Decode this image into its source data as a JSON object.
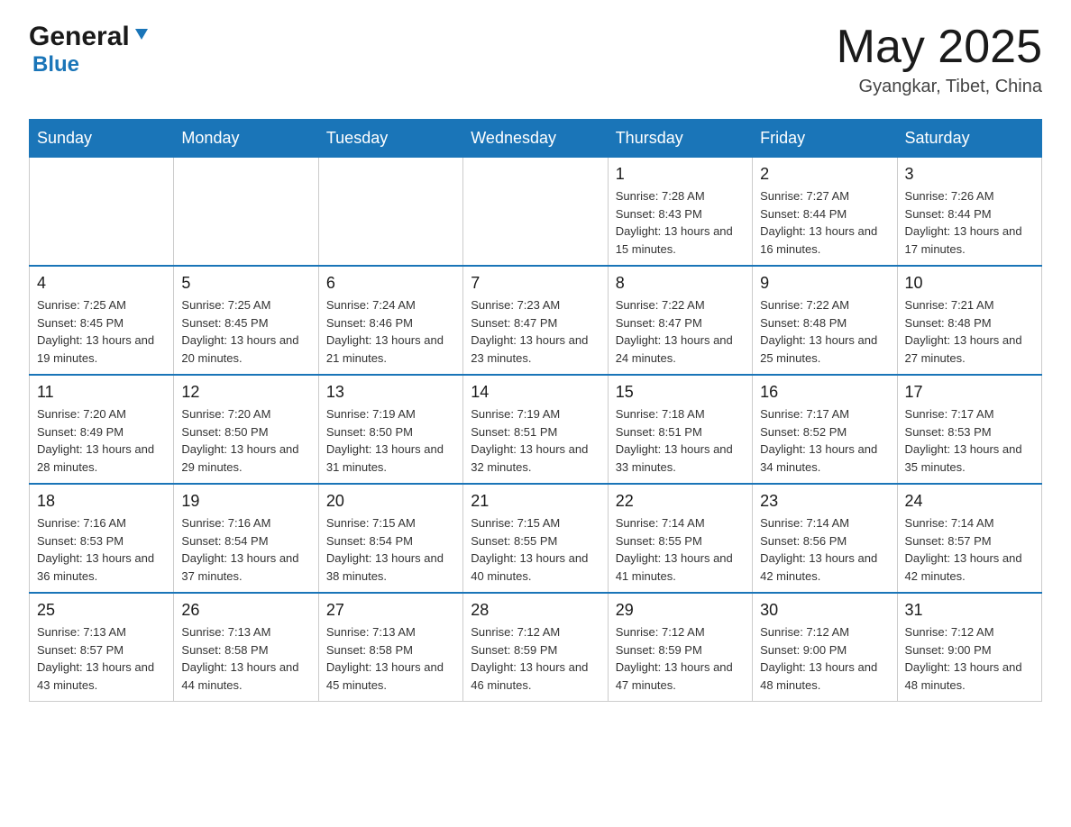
{
  "header": {
    "logo_general": "General",
    "logo_blue": "Blue",
    "month_year": "May 2025",
    "location": "Gyangkar, Tibet, China"
  },
  "days_of_week": [
    "Sunday",
    "Monday",
    "Tuesday",
    "Wednesday",
    "Thursday",
    "Friday",
    "Saturday"
  ],
  "weeks": [
    [
      {
        "day": "",
        "info": ""
      },
      {
        "day": "",
        "info": ""
      },
      {
        "day": "",
        "info": ""
      },
      {
        "day": "",
        "info": ""
      },
      {
        "day": "1",
        "info": "Sunrise: 7:28 AM\nSunset: 8:43 PM\nDaylight: 13 hours and 15 minutes."
      },
      {
        "day": "2",
        "info": "Sunrise: 7:27 AM\nSunset: 8:44 PM\nDaylight: 13 hours and 16 minutes."
      },
      {
        "day": "3",
        "info": "Sunrise: 7:26 AM\nSunset: 8:44 PM\nDaylight: 13 hours and 17 minutes."
      }
    ],
    [
      {
        "day": "4",
        "info": "Sunrise: 7:25 AM\nSunset: 8:45 PM\nDaylight: 13 hours and 19 minutes."
      },
      {
        "day": "5",
        "info": "Sunrise: 7:25 AM\nSunset: 8:45 PM\nDaylight: 13 hours and 20 minutes."
      },
      {
        "day": "6",
        "info": "Sunrise: 7:24 AM\nSunset: 8:46 PM\nDaylight: 13 hours and 21 minutes."
      },
      {
        "day": "7",
        "info": "Sunrise: 7:23 AM\nSunset: 8:47 PM\nDaylight: 13 hours and 23 minutes."
      },
      {
        "day": "8",
        "info": "Sunrise: 7:22 AM\nSunset: 8:47 PM\nDaylight: 13 hours and 24 minutes."
      },
      {
        "day": "9",
        "info": "Sunrise: 7:22 AM\nSunset: 8:48 PM\nDaylight: 13 hours and 25 minutes."
      },
      {
        "day": "10",
        "info": "Sunrise: 7:21 AM\nSunset: 8:48 PM\nDaylight: 13 hours and 27 minutes."
      }
    ],
    [
      {
        "day": "11",
        "info": "Sunrise: 7:20 AM\nSunset: 8:49 PM\nDaylight: 13 hours and 28 minutes."
      },
      {
        "day": "12",
        "info": "Sunrise: 7:20 AM\nSunset: 8:50 PM\nDaylight: 13 hours and 29 minutes."
      },
      {
        "day": "13",
        "info": "Sunrise: 7:19 AM\nSunset: 8:50 PM\nDaylight: 13 hours and 31 minutes."
      },
      {
        "day": "14",
        "info": "Sunrise: 7:19 AM\nSunset: 8:51 PM\nDaylight: 13 hours and 32 minutes."
      },
      {
        "day": "15",
        "info": "Sunrise: 7:18 AM\nSunset: 8:51 PM\nDaylight: 13 hours and 33 minutes."
      },
      {
        "day": "16",
        "info": "Sunrise: 7:17 AM\nSunset: 8:52 PM\nDaylight: 13 hours and 34 minutes."
      },
      {
        "day": "17",
        "info": "Sunrise: 7:17 AM\nSunset: 8:53 PM\nDaylight: 13 hours and 35 minutes."
      }
    ],
    [
      {
        "day": "18",
        "info": "Sunrise: 7:16 AM\nSunset: 8:53 PM\nDaylight: 13 hours and 36 minutes."
      },
      {
        "day": "19",
        "info": "Sunrise: 7:16 AM\nSunset: 8:54 PM\nDaylight: 13 hours and 37 minutes."
      },
      {
        "day": "20",
        "info": "Sunrise: 7:15 AM\nSunset: 8:54 PM\nDaylight: 13 hours and 38 minutes."
      },
      {
        "day": "21",
        "info": "Sunrise: 7:15 AM\nSunset: 8:55 PM\nDaylight: 13 hours and 40 minutes."
      },
      {
        "day": "22",
        "info": "Sunrise: 7:14 AM\nSunset: 8:55 PM\nDaylight: 13 hours and 41 minutes."
      },
      {
        "day": "23",
        "info": "Sunrise: 7:14 AM\nSunset: 8:56 PM\nDaylight: 13 hours and 42 minutes."
      },
      {
        "day": "24",
        "info": "Sunrise: 7:14 AM\nSunset: 8:57 PM\nDaylight: 13 hours and 42 minutes."
      }
    ],
    [
      {
        "day": "25",
        "info": "Sunrise: 7:13 AM\nSunset: 8:57 PM\nDaylight: 13 hours and 43 minutes."
      },
      {
        "day": "26",
        "info": "Sunrise: 7:13 AM\nSunset: 8:58 PM\nDaylight: 13 hours and 44 minutes."
      },
      {
        "day": "27",
        "info": "Sunrise: 7:13 AM\nSunset: 8:58 PM\nDaylight: 13 hours and 45 minutes."
      },
      {
        "day": "28",
        "info": "Sunrise: 7:12 AM\nSunset: 8:59 PM\nDaylight: 13 hours and 46 minutes."
      },
      {
        "day": "29",
        "info": "Sunrise: 7:12 AM\nSunset: 8:59 PM\nDaylight: 13 hours and 47 minutes."
      },
      {
        "day": "30",
        "info": "Sunrise: 7:12 AM\nSunset: 9:00 PM\nDaylight: 13 hours and 48 minutes."
      },
      {
        "day": "31",
        "info": "Sunrise: 7:12 AM\nSunset: 9:00 PM\nDaylight: 13 hours and 48 minutes."
      }
    ]
  ]
}
